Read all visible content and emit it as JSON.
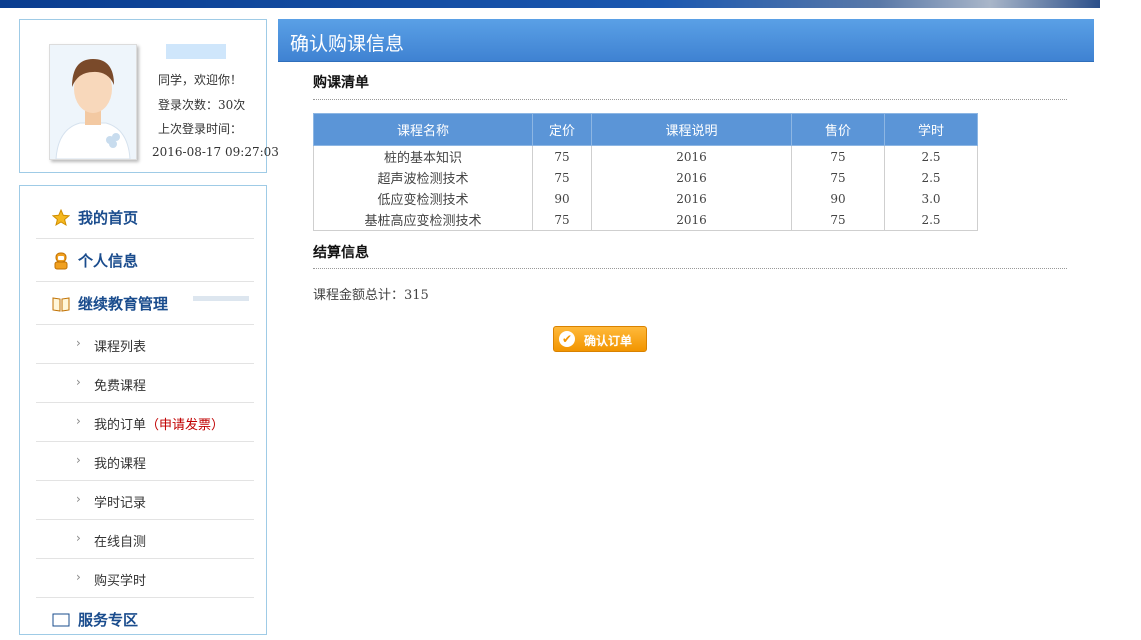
{
  "profile": {
    "greeting": "同学，欢迎你！",
    "login_count": "登录次数：30次",
    "last_login_label": "上次登录时间：",
    "last_login_time": "2016-08-17 09:27:03"
  },
  "menu": {
    "home": "我的首页",
    "personal": "个人信息",
    "continuing_edu": "继续教育管理",
    "course_list": "课程列表",
    "free_courses": "免费课程",
    "my_orders": "我的订单",
    "invoice": "（申请发票）",
    "my_courses": "我的课程",
    "hour_records": "学时记录",
    "online_test": "在线自测",
    "buy_hours": "购买学时",
    "service_partial": "服务专区"
  },
  "page": {
    "title": "确认购课信息",
    "list_title": "购课清单",
    "settle_title": "结算信息",
    "total_label": "课程金额总计：",
    "total_value": "315",
    "confirm_label": "确认订单"
  },
  "table": {
    "headers": [
      "课程名称",
      "定价",
      "课程说明",
      "售价",
      "学时"
    ],
    "rows": [
      [
        "桩的基本知识",
        "75",
        "2016",
        "75",
        "2.5"
      ],
      [
        "超声波检测技术",
        "75",
        "2016",
        "75",
        "2.5"
      ],
      [
        "低应变检测技术",
        "90",
        "2016",
        "90",
        "3.0"
      ],
      [
        "基桩高应变检测技术",
        "75",
        "2016",
        "75",
        "2.5"
      ]
    ]
  },
  "colors": {
    "header_blue": "#3f82d2",
    "menu_text": "#1a4c8d",
    "button_orange": "#f29500",
    "invoice_red": "#c00000"
  }
}
